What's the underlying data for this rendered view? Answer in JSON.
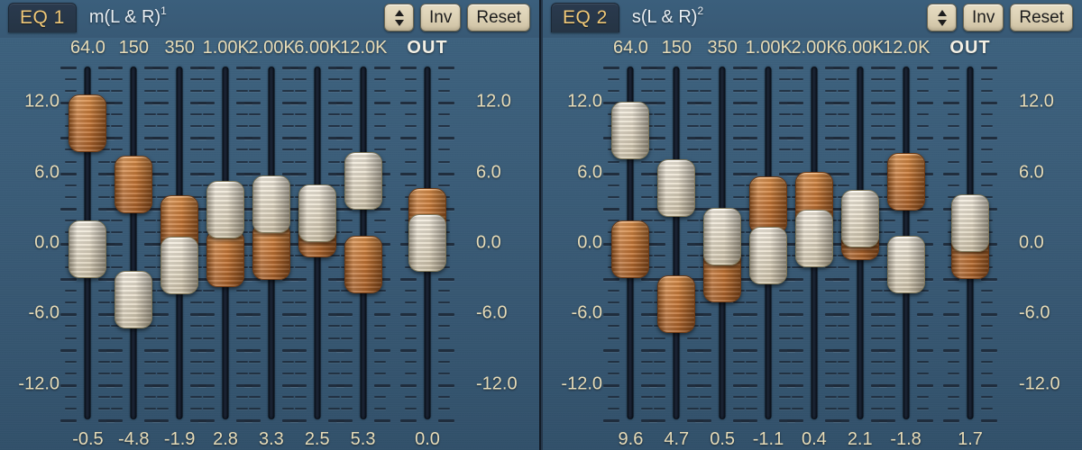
{
  "scale": {
    "labels": [
      "12.0",
      "6.0",
      "0.0",
      "-6.0",
      "-12.0"
    ],
    "db_max": 15,
    "db_min": -15
  },
  "panels": [
    {
      "tab_label": "EQ 1",
      "channel_label": "m(L & R)",
      "channel_sup": "1",
      "stepper_icon": "up-down-arrows-icon",
      "inv_label": "Inv",
      "reset_label": "Reset",
      "out_label": "OUT",
      "out": {
        "value": "0.0",
        "cream_db": 0.0,
        "orange_db": 2.2
      },
      "bands": [
        {
          "freq": "64.0",
          "value": "-0.5",
          "cream_db": -0.5,
          "orange_db": 10.2
        },
        {
          "freq": "150",
          "value": "-4.8",
          "cream_db": -4.8,
          "orange_db": 5.0
        },
        {
          "freq": "350",
          "value": "-1.9",
          "cream_db": -1.9,
          "orange_db": 1.6
        },
        {
          "freq": "1.00K",
          "value": "2.8",
          "cream_db": 2.8,
          "orange_db": -1.3
        },
        {
          "freq": "2.00K",
          "value": "3.3",
          "cream_db": 3.3,
          "orange_db": -0.7
        },
        {
          "freq": "6.00K",
          "value": "2.5",
          "cream_db": 2.5,
          "orange_db": 1.2
        },
        {
          "freq": "12.0K",
          "value": "5.3",
          "cream_db": 5.3,
          "orange_db": -1.8
        }
      ]
    },
    {
      "tab_label": "EQ 2",
      "channel_label": "s(L & R)",
      "channel_sup": "2",
      "stepper_icon": "up-down-arrows-icon",
      "inv_label": "Inv",
      "reset_label": "Reset",
      "out_label": "OUT",
      "out": {
        "value": "1.7",
        "cream_db": 1.7,
        "orange_db": -0.6
      },
      "bands": [
        {
          "freq": "64.0",
          "value": "9.6",
          "cream_db": 9.6,
          "orange_db": -0.5
        },
        {
          "freq": "150",
          "value": "4.7",
          "cream_db": 4.7,
          "orange_db": -5.2
        },
        {
          "freq": "350",
          "value": "0.5",
          "cream_db": 0.5,
          "orange_db": -2.6
        },
        {
          "freq": "1.00K",
          "value": "-1.1",
          "cream_db": -1.1,
          "orange_db": 3.2
        },
        {
          "freq": "2.00K",
          "value": "0.4",
          "cream_db": 0.4,
          "orange_db": 3.6
        },
        {
          "freq": "6.00K",
          "value": "2.1",
          "cream_db": 2.1,
          "orange_db": 1.0
        },
        {
          "freq": "12.0K",
          "value": "-1.8",
          "cream_db": -1.8,
          "orange_db": 5.2
        }
      ]
    }
  ],
  "colors": {
    "panel_blue": "#3a5c78",
    "accent_gold": "#efc878",
    "label_cream": "#e7dcb8",
    "thumb_orange": "#c4702c",
    "thumb_cream": "#e3d9c4",
    "track_navy": "#16202e",
    "button_tan": "#ddd2b6"
  }
}
